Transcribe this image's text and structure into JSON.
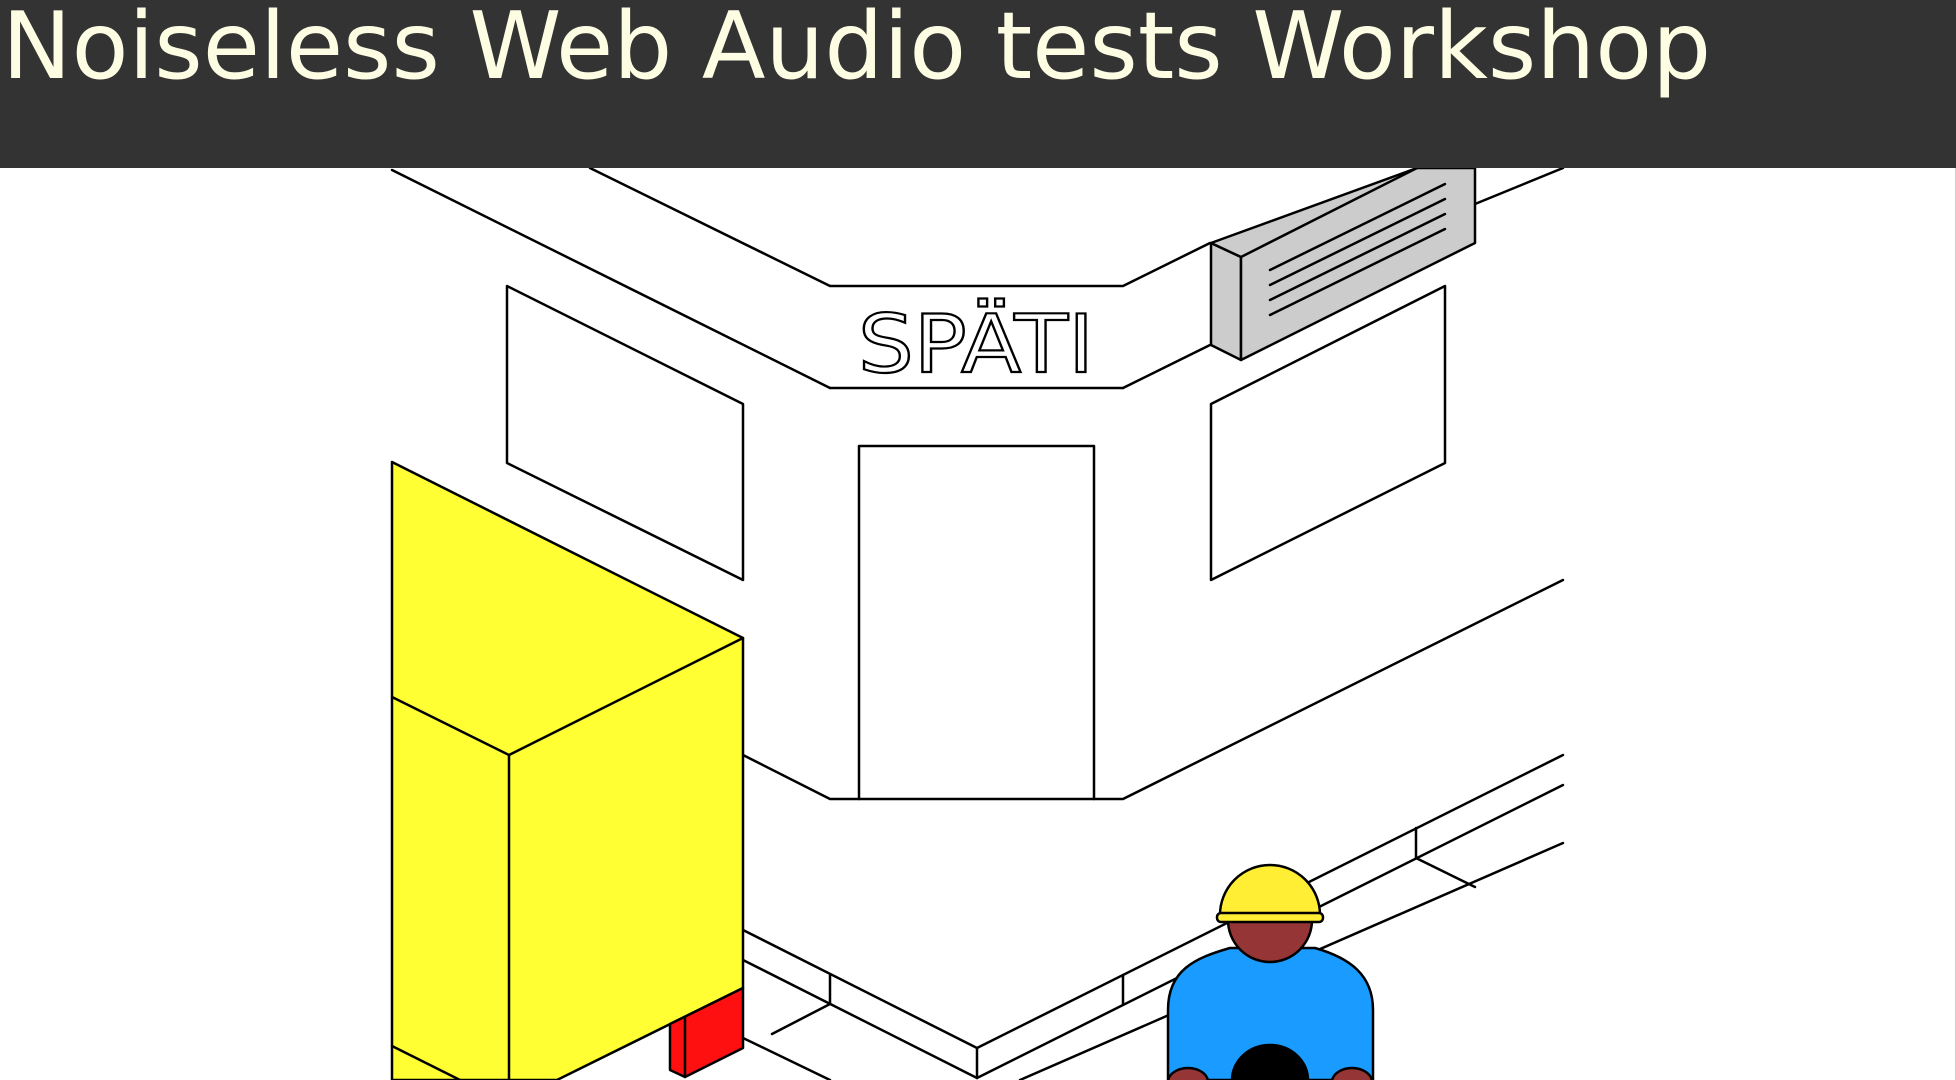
{
  "slide": {
    "title": "Noiseless Web Audio tests Workshop"
  },
  "illustration": {
    "shop_sign": "SPÄTI"
  },
  "colors": {
    "header_background": "#333333",
    "title_text": "#fdfde3",
    "van_yellow": "#ffff33",
    "tail_light_red": "#ff1010",
    "air_conditioner_gray": "#cccccc",
    "person_shirt_blue": "#1a9bff",
    "person_skin": "#953535",
    "person_helmet_yellow": "#ffee33"
  }
}
